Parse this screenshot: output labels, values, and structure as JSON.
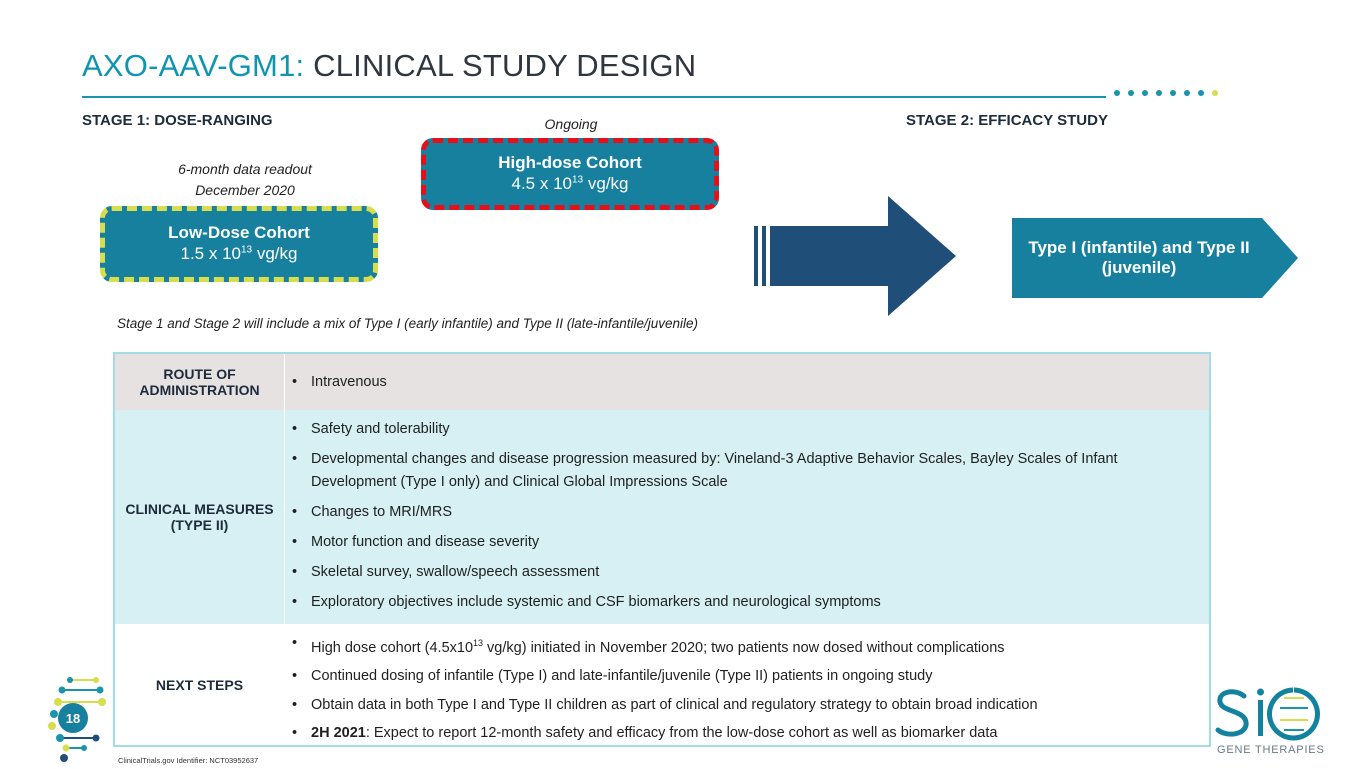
{
  "title": {
    "accent": "AXO-AAV-GM1:",
    "rest": " CLINICAL STUDY DESIGN"
  },
  "colors": {
    "accent": "#0e96b0",
    "cohort_fill": "#17809f",
    "arrow": "#1f4e79",
    "low_border": "#d8dd4e",
    "high_border": "#e4101a"
  },
  "stage1": {
    "heading": "STAGE 1: DOSE-RANGING",
    "low_note_1": "6-month data readout",
    "low_note_2": "December 2020",
    "low_name": "Low-Dose Cohort",
    "low_dose_pre": "1.5 x 10",
    "low_dose_exp": "13",
    "low_dose_unit": " vg/kg",
    "ongoing": "Ongoing",
    "high_name": "High-dose Cohort",
    "high_dose_pre": "4.5 x 10",
    "high_dose_exp": "13",
    "high_dose_unit": " vg/kg"
  },
  "stage2": {
    "heading": "STAGE 2: EFFICACY STUDY",
    "banner": "Type I (infantile) and Type II (juvenile)"
  },
  "mix_note": "Stage 1 and Stage 2 will include a mix of Type I (early infantile) and Type II (late-infantile/juvenile)",
  "table": {
    "route_label": "ROUTE OF ADMINISTRATION",
    "route_items": [
      "Intravenous"
    ],
    "clinical_label": "CLINICAL MEASURES (TYPE II)",
    "clinical_items": [
      "Safety and tolerability",
      "Developmental changes and disease progression measured by: Vineland-3 Adaptive Behavior Scales, Bayley Scales of Infant Development (Type I only) and Clinical Global Impressions Scale",
      "Changes to MRI/MRS",
      "Motor function and disease severity",
      "Skeletal survey, swallow/speech assessment",
      "Exploratory objectives include systemic and CSF biomarkers and neurological symptoms"
    ],
    "next_label": "NEXT STEPS",
    "next_item_1_pre": "High dose cohort (4.5x10",
    "next_item_1_exp": "13",
    "next_item_1_post": " vg/kg) initiated in November 2020; two patients now dosed without complications",
    "next_items": [
      "Continued dosing of infantile (Type I) and late-infantile/juvenile (Type II) patients in ongoing study",
      "Obtain data in both Type I and Type II children as part of clinical and regulatory strategy to obtain broad indication"
    ],
    "next_item_4_bold": "2H 2021",
    "next_item_4_rest": ": Expect to report 12-month safety and efficacy from the low-dose cohort as well as biomarker data"
  },
  "footnote": "ClinicalTrials.gov Identifier: NCT03952637",
  "page_number": "18",
  "logo": {
    "text": "SIO",
    "subtitle": "GENE THERAPIES"
  }
}
